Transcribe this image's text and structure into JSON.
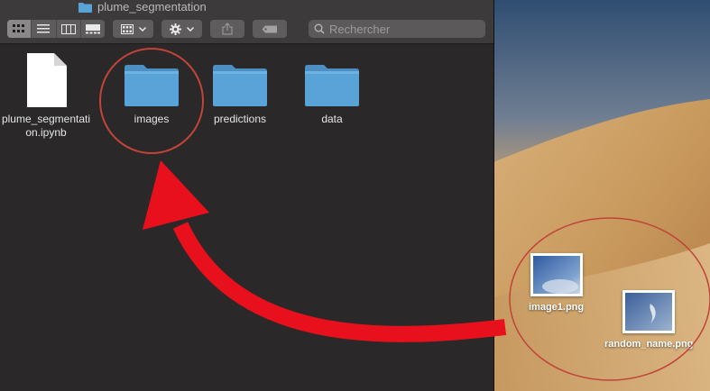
{
  "window": {
    "title": "plume_segmentation"
  },
  "toolbar": {
    "view_buttons": [
      "icon-view-icon",
      "list-view-icon",
      "column-view-icon",
      "gallery-view-icon"
    ],
    "group_button": "group-icon",
    "action_button": "gear-icon",
    "share_button": "share-icon",
    "tag_button": "tag-icon"
  },
  "search": {
    "placeholder": "Rechercher"
  },
  "files": [
    {
      "name": "plume_segmentati",
      "name2": "on.ipynb",
      "kind": "document"
    },
    {
      "name": "images",
      "kind": "folder"
    },
    {
      "name": "predictions",
      "kind": "folder"
    },
    {
      "name": "data",
      "kind": "folder"
    }
  ],
  "desktop_files": [
    {
      "name": "image1.png"
    },
    {
      "name": "random_name.png"
    }
  ],
  "colors": {
    "folder": "#5aa3d8",
    "annotation_arrow": "#e8101c",
    "annotation_circle": "#c1443a",
    "window_bg": "#2a2828"
  }
}
